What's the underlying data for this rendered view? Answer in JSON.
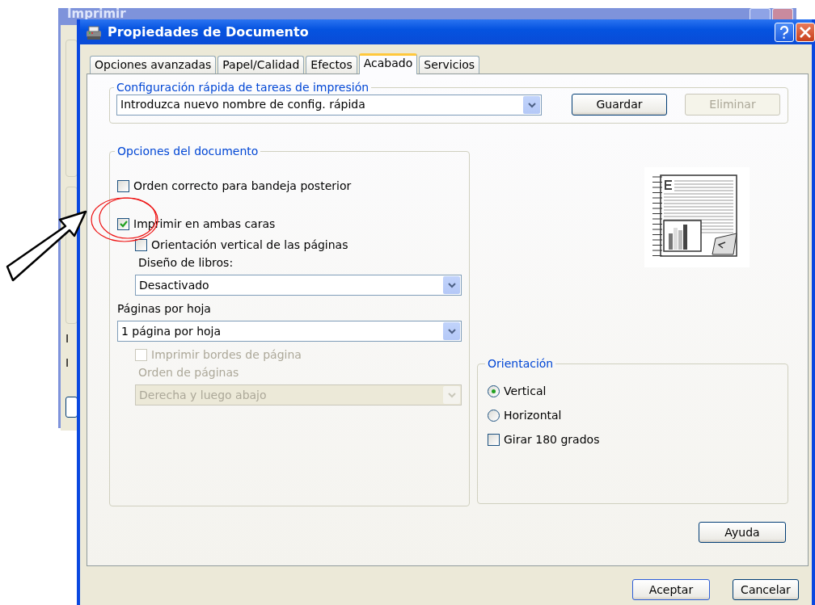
{
  "background_window": {
    "title": "Imprimir",
    "labels": [
      "I",
      "I"
    ]
  },
  "window": {
    "title": "Propiedades de Documento"
  },
  "tabs": [
    {
      "label": "Opciones avanzadas",
      "selected": false
    },
    {
      "label": "Papel/Calidad",
      "selected": false
    },
    {
      "label": "Efectos",
      "selected": false
    },
    {
      "label": "Acabado",
      "selected": true
    },
    {
      "label": "Servicios",
      "selected": false
    }
  ],
  "quick_config": {
    "legend": "Configuración rápida de tareas de impresión",
    "value": "Introduzca nuevo nombre de config. rápida",
    "buttons": [
      {
        "label": "Guardar",
        "disabled": false
      },
      {
        "label": "Eliminar",
        "disabled": true
      }
    ]
  },
  "document_options": {
    "legend": "Opciones del documento",
    "items": [
      {
        "kind": "checkbox",
        "label": "Orden correcto para bandeja posterior",
        "checked": false,
        "disabled": false
      },
      {
        "kind": "checkbox",
        "label": "Imprimir en ambas caras",
        "checked": true,
        "disabled": false,
        "children": [
          {
            "kind": "checkbox",
            "label": "Orientación vertical de las páginas",
            "checked": false,
            "disabled": false
          },
          {
            "kind": "label",
            "label": "Diseño de libros:",
            "disabled": false
          },
          {
            "kind": "select",
            "value": "Desactivado",
            "disabled": false
          }
        ]
      },
      {
        "kind": "label",
        "label": "Páginas por hoja",
        "disabled": false
      },
      {
        "kind": "select",
        "value": "1 página por hoja",
        "disabled": false,
        "children": [
          {
            "kind": "checkbox",
            "label": "Imprimir bordes de página",
            "checked": false,
            "disabled": true
          },
          {
            "kind": "label",
            "label": "Orden de páginas",
            "disabled": true
          },
          {
            "kind": "select",
            "value": "Derecha y luego abajo",
            "disabled": true
          }
        ]
      }
    ]
  },
  "orientation": {
    "legend": "Orientación",
    "options": [
      {
        "kind": "radio",
        "label": "Vertical",
        "selected": true
      },
      {
        "kind": "radio",
        "label": "Horizontal",
        "selected": false
      },
      {
        "kind": "checkbox",
        "label": "Girar 180 grados",
        "checked": false
      }
    ]
  },
  "help_button": "Ayuda",
  "dialog_buttons": [
    "Aceptar",
    "Cancelar"
  ]
}
